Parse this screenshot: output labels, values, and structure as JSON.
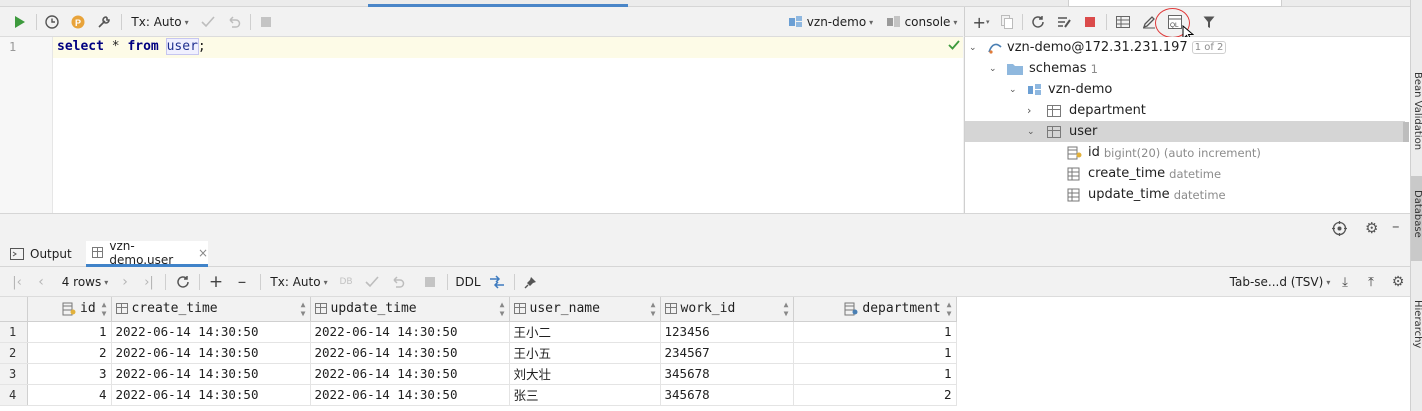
{
  "editor_toolbar": {
    "tx_label": "Tx: Auto",
    "datasource": "vzn-demo",
    "console": "console"
  },
  "editor": {
    "line_number": "1",
    "sql": {
      "kw1": "select",
      "star": " * ",
      "kw2": "from",
      "table": "user",
      "end": ";"
    }
  },
  "db_tree": {
    "connection": "vzn-demo@172.31.231.197",
    "connection_badge": "1 of 2",
    "schemas_label": "schemas",
    "schemas_count": "1",
    "schema": "vzn-demo",
    "tables": [
      "department",
      "user"
    ],
    "columns": [
      {
        "name": "id",
        "type": "bigint(20) (auto increment)"
      },
      {
        "name": "create_time",
        "type": "datetime"
      },
      {
        "name": "update_time",
        "type": "datetime"
      }
    ]
  },
  "bottom_tabs": {
    "output": "Output",
    "result": "vzn-demo.user"
  },
  "result_toolbar": {
    "rows": "4 rows",
    "tx_label": "Tx: Auto",
    "ddl": "DDL",
    "export_format": "Tab-se...d (TSV)"
  },
  "result": {
    "columns": [
      "id",
      "create_time",
      "update_time",
      "user_name",
      "work_id",
      "department"
    ],
    "rows": [
      {
        "n": "1",
        "id": "1",
        "create_time": "2022-06-14 14:30:50",
        "update_time": "2022-06-14 14:30:50",
        "user_name": "王小二",
        "work_id": "123456",
        "department": "1"
      },
      {
        "n": "2",
        "id": "2",
        "create_time": "2022-06-14 14:30:50",
        "update_time": "2022-06-14 14:30:50",
        "user_name": "王小五",
        "work_id": "234567",
        "department": "1"
      },
      {
        "n": "3",
        "id": "3",
        "create_time": "2022-06-14 14:30:50",
        "update_time": "2022-06-14 14:30:50",
        "user_name": "刘大壮",
        "work_id": "345678",
        "department": "1"
      },
      {
        "n": "4",
        "id": "4",
        "create_time": "2022-06-14 14:30:50",
        "update_time": "2022-06-14 14:30:50",
        "user_name": "张三",
        "work_id": "345678",
        "department": "2"
      }
    ]
  },
  "side_strip": {
    "bean_validation": "Bean Validation",
    "database": "Database",
    "hierarchy": "Hierarchy"
  },
  "colors": {
    "accent": "#4083c9",
    "run_green": "#3d9a3d",
    "stop_red": "#db4b4b"
  }
}
